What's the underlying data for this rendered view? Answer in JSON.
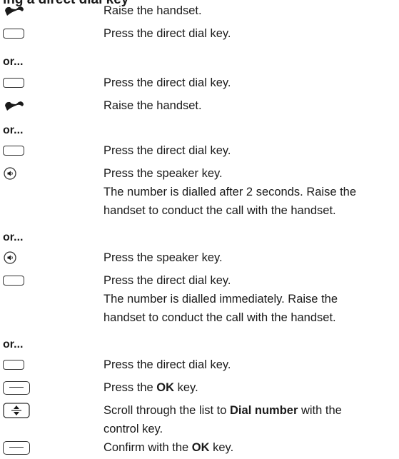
{
  "heading_fragment": "ing a direct dial key",
  "separator": "or...",
  "groups": [
    {
      "steps": [
        {
          "icon": "handset-icon",
          "text": "Raise the handset."
        },
        {
          "icon": "direct-dial-key-icon",
          "text": "Press the direct dial key."
        }
      ]
    },
    {
      "steps": [
        {
          "icon": "direct-dial-key-icon",
          "text": "Press the direct dial key."
        },
        {
          "icon": "handset-icon",
          "text": "Raise the handset."
        }
      ]
    },
    {
      "steps": [
        {
          "icon": "direct-dial-key-icon",
          "text": "Press the direct dial key."
        },
        {
          "icon": "speaker-key-icon",
          "text": "Press the speaker key.",
          "note": [
            "The number is dialled after 2 seconds. Raise the",
            "handset to conduct the call with the handset."
          ]
        }
      ]
    },
    {
      "steps": [
        {
          "icon": "speaker-key-icon",
          "text": "Press the speaker key."
        },
        {
          "icon": "direct-dial-key-icon",
          "text": "Press the direct dial key.",
          "note": [
            "The number is dialled immediately. Raise the",
            "handset to conduct the call with the handset."
          ]
        }
      ]
    },
    {
      "steps": [
        {
          "icon": "direct-dial-key-icon",
          "text": "Press the direct dial key."
        },
        {
          "icon": "ok-key-icon",
          "text_pre": "Press the ",
          "text_bold": "OK",
          "text_post": " key."
        },
        {
          "icon": "control-key-icon",
          "text_pre": "Scroll through the list to ",
          "text_bold": "Dial number",
          "text_post": " with the",
          "note": [
            "control key."
          ]
        },
        {
          "icon": "ok-key-icon",
          "text_pre": "Confirm with the ",
          "text_bold": "OK",
          "text_post": " key."
        }
      ]
    }
  ]
}
